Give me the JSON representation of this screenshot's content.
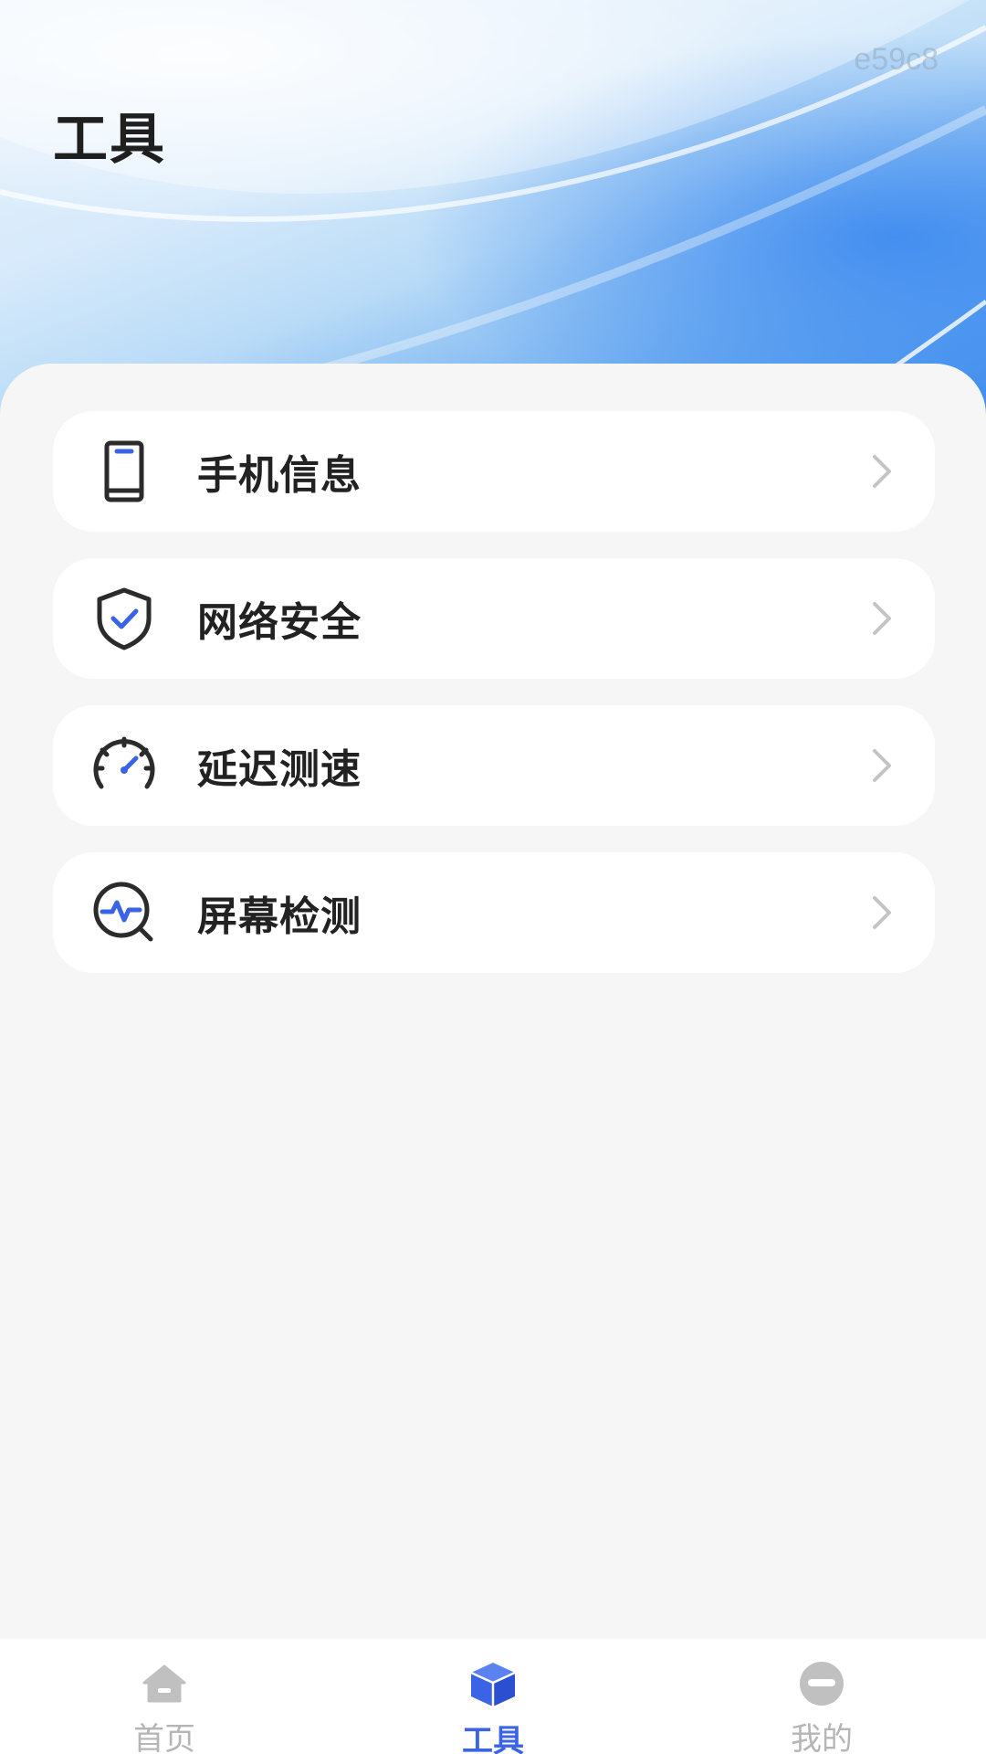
{
  "header": {
    "title": "工具",
    "watermark": "e59c8"
  },
  "menu": {
    "items": [
      {
        "label": "手机信息",
        "icon": "phone-icon"
      },
      {
        "label": "网络安全",
        "icon": "shield-check-icon"
      },
      {
        "label": "延迟测速",
        "icon": "speedometer-icon"
      },
      {
        "label": "屏幕检测",
        "icon": "screen-detect-icon"
      }
    ]
  },
  "bottom_nav": {
    "items": [
      {
        "label": "首页",
        "icon": "home-icon",
        "active": false
      },
      {
        "label": "工具",
        "icon": "cube-icon",
        "active": true
      },
      {
        "label": "我的",
        "icon": "profile-icon",
        "active": false
      }
    ]
  },
  "colors": {
    "accent": "#3a63e6",
    "inactive": "#b5b5b5",
    "icon_stroke": "#2b2b2b"
  }
}
